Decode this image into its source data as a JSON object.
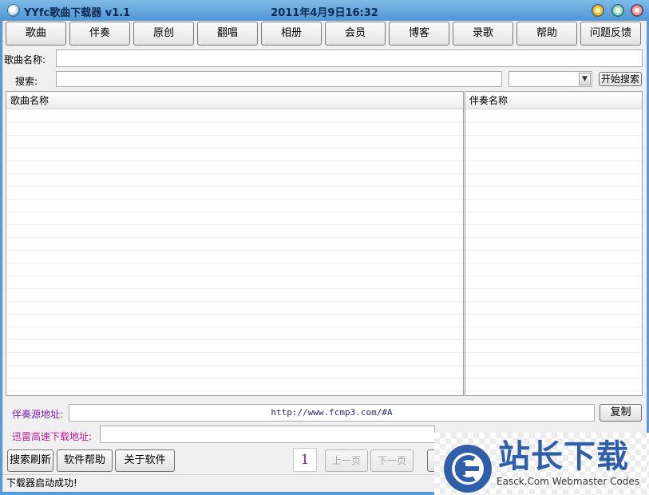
{
  "window": {
    "title": "YYfc歌曲下载器 v1.1",
    "datetime": "2011年4月9日16:32"
  },
  "nav": [
    "歌曲",
    "伴奏",
    "原创",
    "翻唱",
    "相册",
    "会员",
    "博客",
    "录歌",
    "帮助",
    "问题反馈"
  ],
  "song_name": {
    "label": "歌曲名称:",
    "value": ""
  },
  "search": {
    "label": "搜索:",
    "value": "",
    "select_value": "",
    "button": "开始搜索"
  },
  "left_list": {
    "header": "歌曲名称"
  },
  "right_list": {
    "header": "伴奏名称"
  },
  "accompaniment_source": {
    "label": "伴奏源地址:",
    "value": "http://www.fcmp3.com/#A",
    "copy_button": "复制"
  },
  "thunder_url": {
    "label": "迅雷高速下载地址:",
    "value": ""
  },
  "bottom": {
    "refresh_button": "搜索刷新",
    "help_button": "软件帮助",
    "about_button": "关于软件",
    "page_number": "1",
    "prev_button": "上一页",
    "next_button": "下一页"
  },
  "status": "下载器启动成功!",
  "watermark": {
    "cn": "站长下载",
    "en": "Easck.Com Webmaster Codes"
  },
  "colors": {
    "title_gradient_top": "#7fbbe8",
    "title_gradient_bottom": "#4f95d6",
    "label_purple": "#7a1fb0",
    "thunder_label_pink": "#c2189a",
    "watermark_blue": "#2e5fa8"
  }
}
